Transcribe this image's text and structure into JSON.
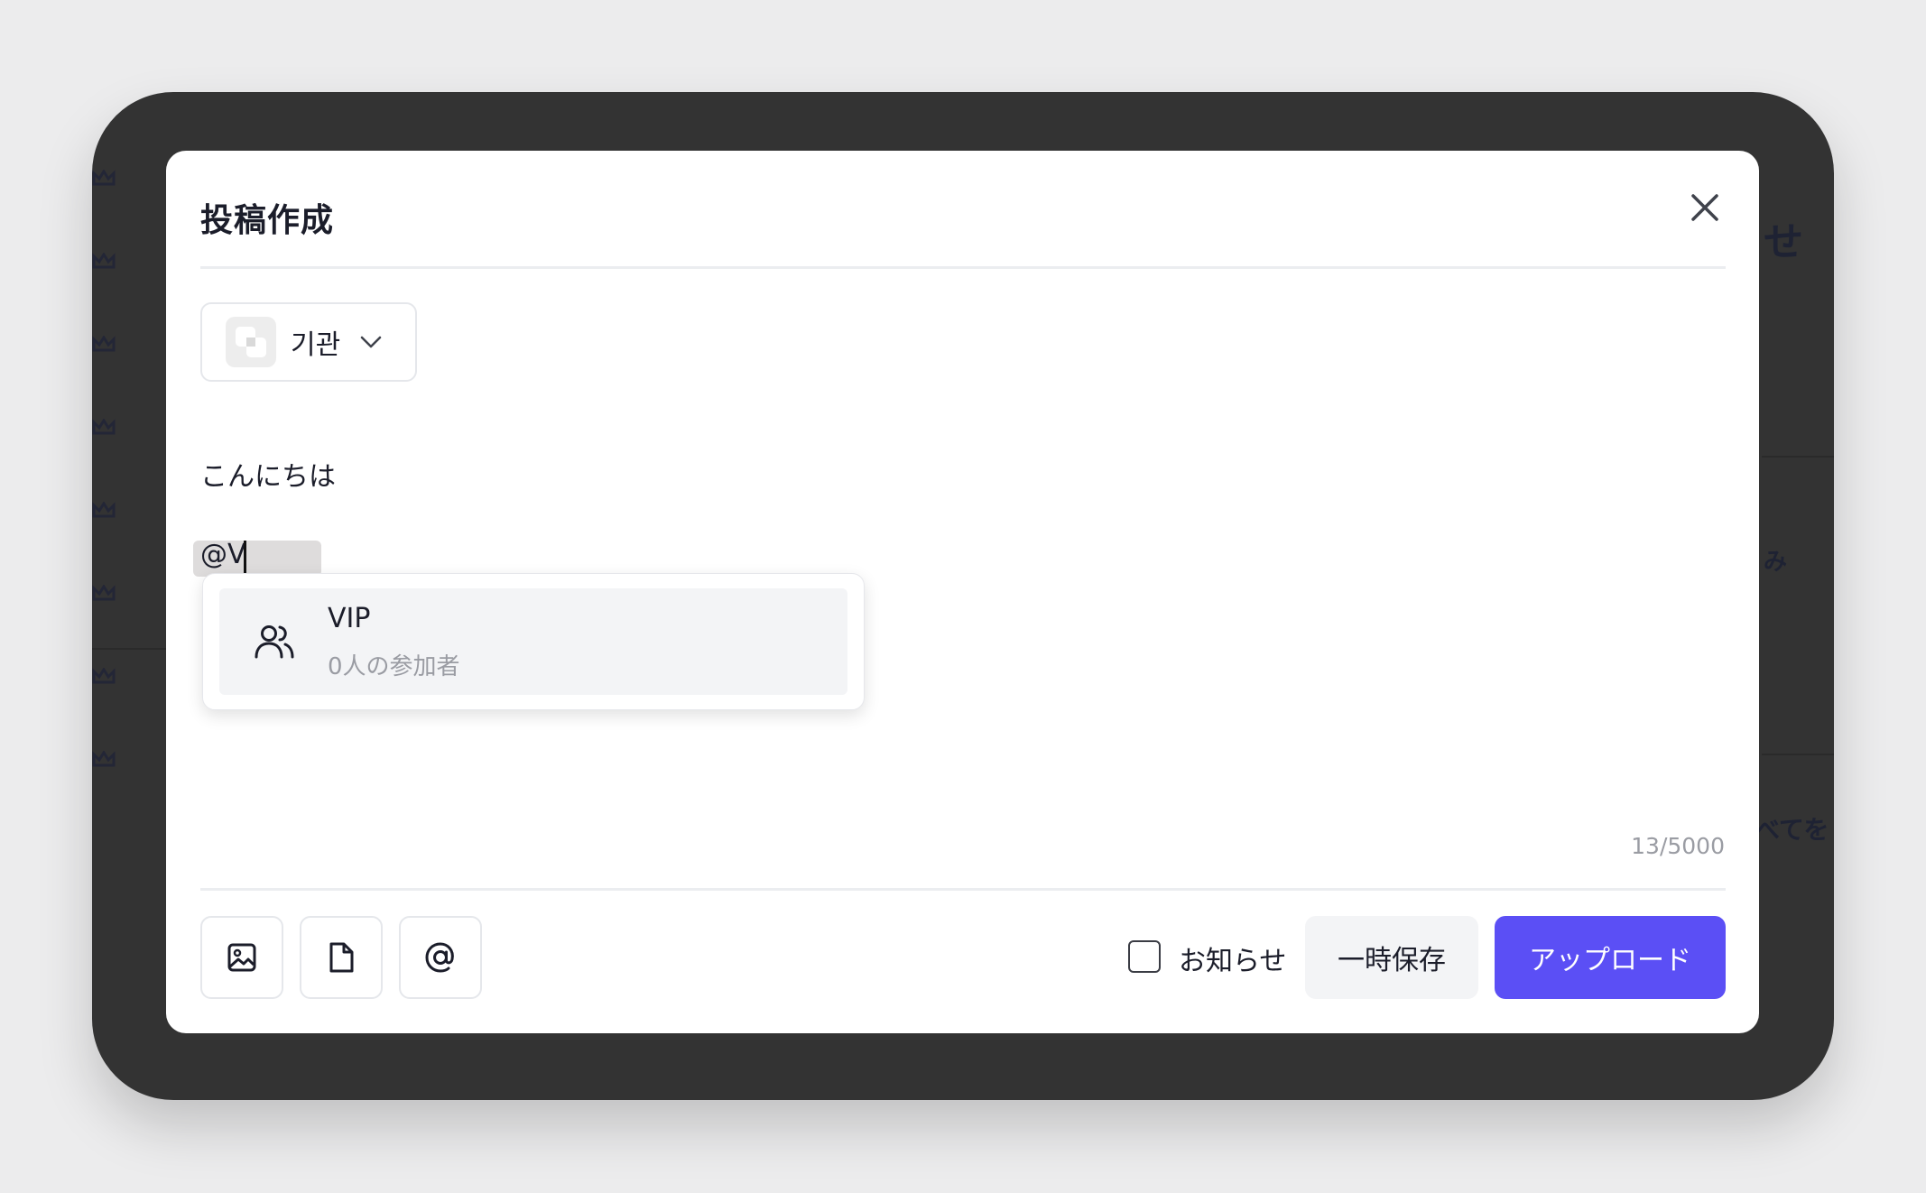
{
  "modal": {
    "title": "投稿作成",
    "account": {
      "name": "기관"
    },
    "editor": {
      "line1": "こんにちは",
      "mention_query": "@V"
    },
    "suggestion": {
      "name": "VIP",
      "subtitle": "0人の参加者"
    },
    "char_counter": "13/5000",
    "footer": {
      "tools": [
        "image-icon",
        "file-icon",
        "mention-icon"
      ],
      "notice_label": "お知らせ",
      "notice_checked": false,
      "draft_label": "一時保存",
      "upload_label": "アップロード"
    }
  },
  "background": {
    "right_text_top": "せ",
    "right_text_mid": "み",
    "right_text_bottom": "べてを"
  },
  "colors": {
    "accent": "#5b4ff5",
    "device_frame": "#333333",
    "page_bg": "#ececed"
  }
}
